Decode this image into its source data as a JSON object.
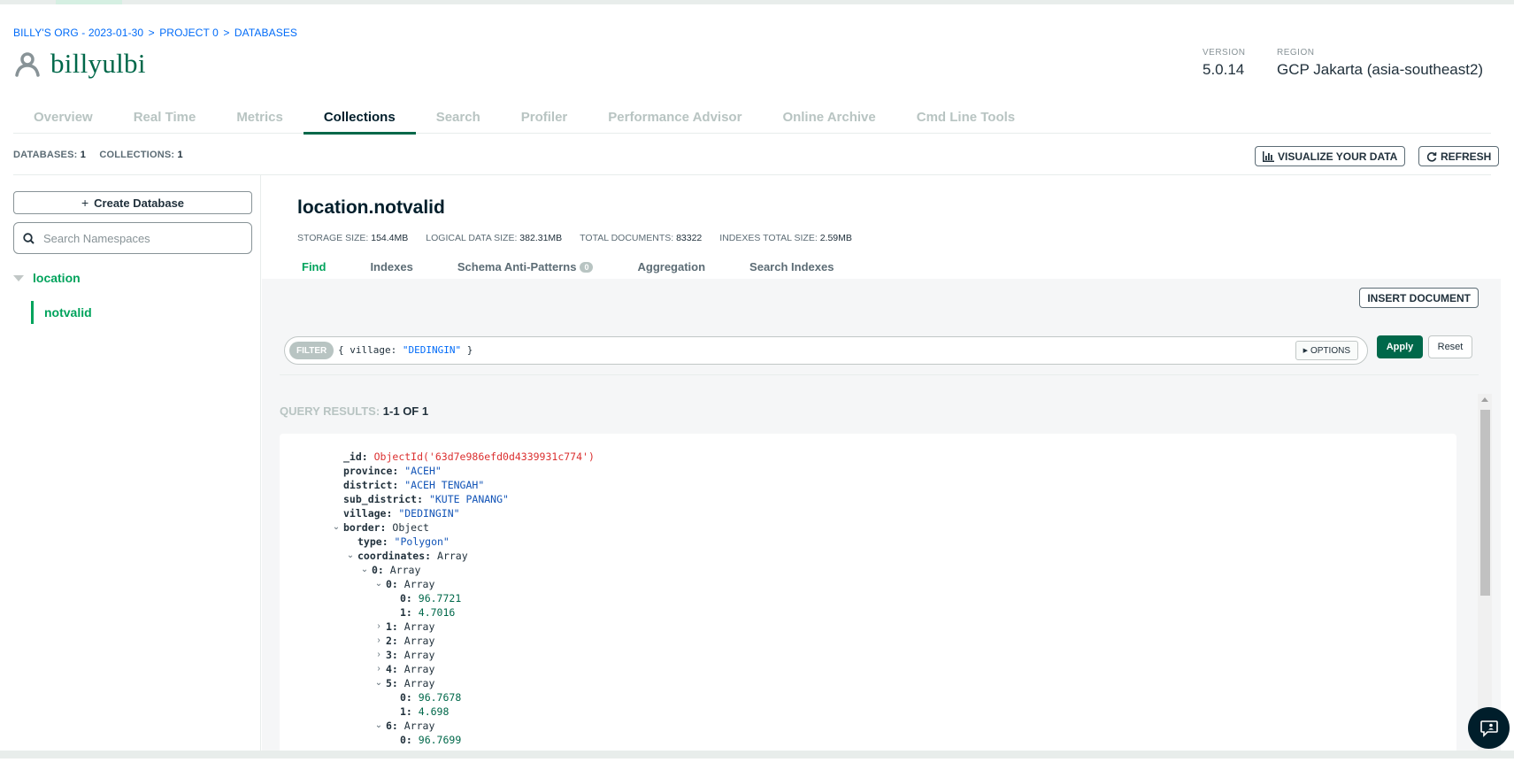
{
  "breadcrumb": {
    "org": "BILLY'S ORG - 2023-01-30",
    "project": "PROJECT 0",
    "page": "DATABASES",
    "separator": ">"
  },
  "cluster": {
    "name": "billyulbi",
    "icon": "user-icon"
  },
  "meta": {
    "version_label": "VERSION",
    "version": "5.0.14",
    "region_label": "REGION",
    "region": "GCP Jakarta (asia-southeast2)"
  },
  "tabs": [
    {
      "label": "Overview"
    },
    {
      "label": "Real Time"
    },
    {
      "label": "Metrics"
    },
    {
      "label": "Collections"
    },
    {
      "label": "Search"
    },
    {
      "label": "Profiler"
    },
    {
      "label": "Performance Advisor"
    },
    {
      "label": "Online Archive"
    },
    {
      "label": "Cmd Line Tools"
    }
  ],
  "active_tab": "Collections",
  "counts": {
    "databases_label": "DATABASES:",
    "databases": "1",
    "collections_label": "COLLECTIONS:",
    "collections": "1"
  },
  "toolbar": {
    "visualize": "VISUALIZE YOUR DATA",
    "refresh": "REFRESH"
  },
  "sidebar": {
    "create_db": "Create Database",
    "search_placeholder": "Search Namespaces",
    "database": "location",
    "collection": "notvalid"
  },
  "collection": {
    "title": "location.notvalid",
    "storage_label": "STORAGE SIZE:",
    "storage": "154.4MB",
    "logical_label": "LOGICAL DATA SIZE:",
    "logical": "382.31MB",
    "docs_label": "TOTAL DOCUMENTS:",
    "docs": "83322",
    "indexes_label": "INDEXES TOTAL SIZE:",
    "indexes": "2.59MB"
  },
  "subtabs": {
    "find": "Find",
    "indexes": "Indexes",
    "schema": "Schema Anti-Patterns",
    "schema_count": "0",
    "aggregation": "Aggregation",
    "search_indexes": "Search Indexes"
  },
  "insert_label": "INSERT DOCUMENT",
  "filter": {
    "pill": "FILTER",
    "open": "{ village: ",
    "value": "\"DEDINGIN\"",
    "close": " }",
    "options": "OPTIONS",
    "apply": "Apply",
    "reset": "Reset"
  },
  "query_results": {
    "label": "QUERY RESULTS:",
    "range": "1-1 OF 1"
  },
  "document": {
    "lines": [
      {
        "key": "_id",
        "value": "ObjectId('63d7e986efd0d4339931c774')"
      },
      {
        "key": "province",
        "value": "\"ACEH\""
      },
      {
        "key": "district",
        "value": "\"ACEH TENGAH\""
      },
      {
        "key": "sub_district",
        "value": "\"KUTE PANANG\""
      },
      {
        "key": "village",
        "value": "\"DEDINGIN\""
      },
      {
        "key": "border",
        "value": "Object"
      },
      {
        "key": "type",
        "value": "\"Polygon\""
      },
      {
        "key": "coordinates",
        "value": "Array"
      },
      {
        "key": "0",
        "value": "Array"
      },
      {
        "key": "0",
        "value": "Array"
      },
      {
        "key": "0",
        "value": "96.7721"
      },
      {
        "key": "1",
        "value": "4.7016"
      },
      {
        "key": "1",
        "value": "Array"
      },
      {
        "key": "2",
        "value": "Array"
      },
      {
        "key": "3",
        "value": "Array"
      },
      {
        "key": "4",
        "value": "Array"
      },
      {
        "key": "5",
        "value": "Array"
      },
      {
        "key": "0",
        "value": "96.7678"
      },
      {
        "key": "1",
        "value": "4.698"
      },
      {
        "key": "6",
        "value": "Array"
      },
      {
        "key": "0",
        "value": "96.7699"
      }
    ]
  },
  "colors": {
    "brand_green": "#00684a",
    "accent_green": "#00a35c",
    "link_blue": "#016bf8",
    "oid_red": "#db3030"
  }
}
